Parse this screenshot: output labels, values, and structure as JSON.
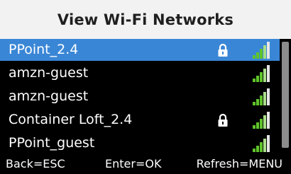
{
  "title": "View Wi-Fi Networks",
  "networks": [
    {
      "name": "PPoint_2.4",
      "locked": true,
      "selected": true,
      "signal_bars": 5
    },
    {
      "name": "amzn-guest",
      "locked": false,
      "selected": false,
      "signal_bars": 5
    },
    {
      "name": "amzn-guest",
      "locked": false,
      "selected": false,
      "signal_bars": 5
    },
    {
      "name": "Container Loft_2.4",
      "locked": true,
      "selected": false,
      "signal_bars": 5
    },
    {
      "name": "PPoint_guest",
      "locked": false,
      "selected": false,
      "signal_bars": 5
    }
  ],
  "footer": {
    "back": "Back=ESC",
    "enter": "Enter=OK",
    "refresh": "Refresh=MENU"
  },
  "colors": {
    "selected_row": "#3a86d6",
    "signal_active": "#5fc42a",
    "signal_inactive": "#d9d9d9",
    "background": "#000000"
  },
  "icons": {
    "lock": "lock-icon",
    "signal": "wifi-signal-icon"
  }
}
